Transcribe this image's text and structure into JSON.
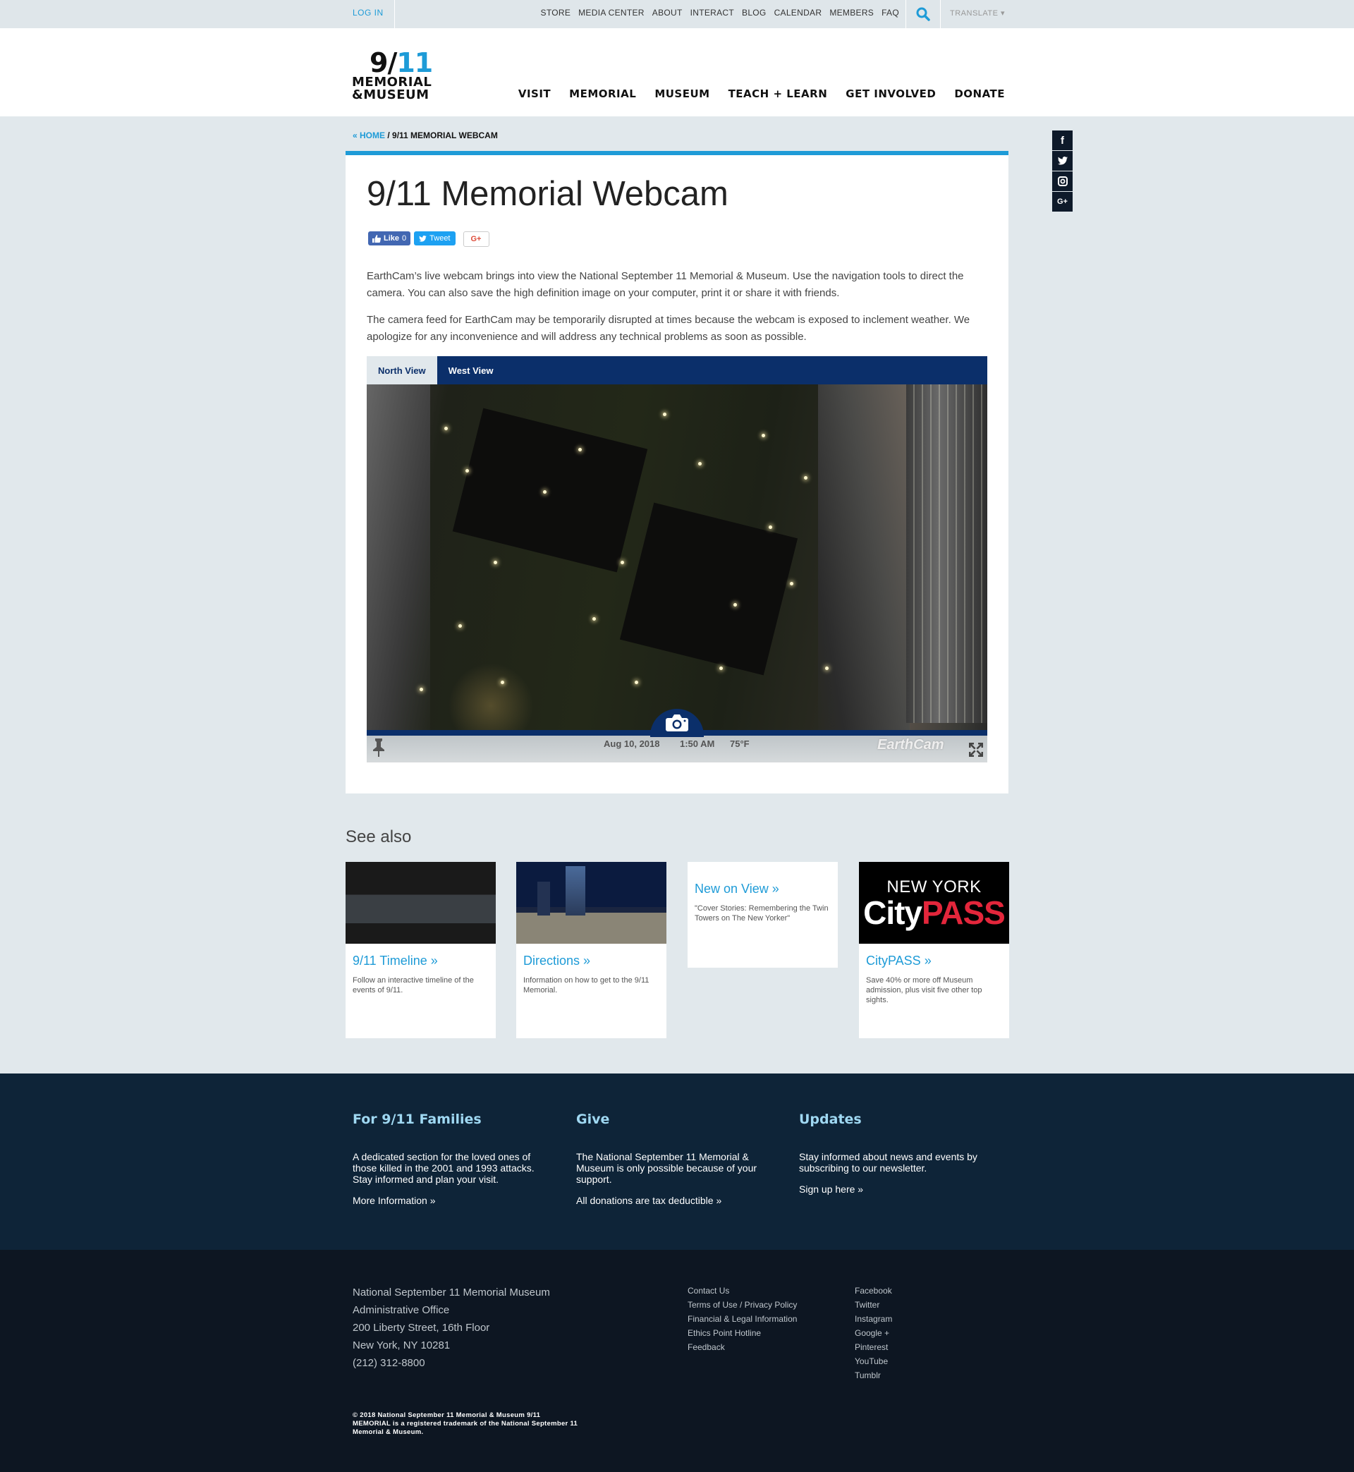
{
  "utility": {
    "login": "LOG IN",
    "links": [
      "STORE",
      "MEDIA CENTER",
      "ABOUT",
      "INTERACT",
      "BLOG",
      "CALENDAR",
      "MEMBERS",
      "FAQ"
    ],
    "translate": "TRANSLATE ▾"
  },
  "logo": {
    "num_a": "9/",
    "num_b": "11",
    "line1": "MEMORIAL",
    "line2": "&MUSEUM"
  },
  "nav": [
    "VISIT",
    "MEMORIAL",
    "MUSEUM",
    "TEACH + LEARN",
    "GET INVOLVED",
    "DONATE"
  ],
  "breadcrumb": {
    "home": "« HOME",
    "sep": " / ",
    "current": "9/11 MEMORIAL WEBCAM"
  },
  "social_side": [
    "f",
    "t",
    "◘",
    "G+"
  ],
  "page": {
    "title": "9/11 Memorial Webcam",
    "share": {
      "like": "Like",
      "like_count": "0",
      "tweet": "Tweet",
      "gplus": "G+"
    },
    "paragraph1": "EarthCam’s live webcam brings into view the National September 11 Memorial & Museum. Use the navigation tools to direct the camera. You can also save the high definition image on your computer, print it or share it with friends.",
    "paragraph2": "The camera feed for EarthCam may be temporarily disrupted at times because the webcam is exposed to inclement weather. We apologize for any inconvenience and will address any technical problems as soon as possible."
  },
  "webcam": {
    "tabs": [
      "North View",
      "West View"
    ],
    "date": "Aug 10, 2018",
    "time": "1:50 AM",
    "temp": "75°F",
    "brand": "EarthCam"
  },
  "see_also": {
    "title": "See also",
    "tiles": [
      {
        "title": "9/11 Timeline »",
        "desc": "Follow an interactive timeline of the events of 9/11."
      },
      {
        "title": "Directions »",
        "desc": "Information on how to get to the 9/11 Memorial."
      },
      {
        "title": "New on View »",
        "desc": "\"Cover Stories: Remembering the Twin Towers on The New Yorker\""
      },
      {
        "title": "CityPASS »",
        "desc": "Save 40% or more off Museum admission, plus visit five other top sights.",
        "img_line1": "NEW YORK",
        "img_city": "City",
        "img_pass": "PASS"
      }
    ]
  },
  "footer_top": [
    {
      "title": "For 9/11 Families",
      "text": "A dedicated section for the loved ones of those killed in the 2001 and 1993 attacks. Stay informed and plan your visit.",
      "link": "More Information »"
    },
    {
      "title": "Give",
      "text": "The National September 11 Memorial & Museum is only possible because of your support.",
      "link": "All donations are tax deductible »"
    },
    {
      "title": "Updates",
      "text": "Stay informed about news and events by subscribing to our newsletter.",
      "link": "Sign up here »"
    }
  ],
  "footer_bottom": {
    "address": [
      "National September 11 Memorial Museum",
      "Administrative Office",
      "200 Liberty Street, 16th Floor",
      "New York, NY 10281",
      "(212) 312-8800"
    ],
    "links": [
      "Contact Us",
      "Terms of Use / Privacy Policy",
      "Financial & Legal Information",
      "Ethics Point Hotline",
      "Feedback"
    ],
    "social": [
      "Facebook",
      "Twitter",
      "Instagram",
      "Google +",
      "Pinterest",
      "YouTube",
      "Tumblr"
    ],
    "copyright": "© 2018 National September 11 Memorial & Museum 9/11 MEMORIAL is a registered trademark of the National September 11 Memorial & Museum."
  },
  "colors": {
    "accent": "#1e9bd7",
    "navy": "#0b2f6a",
    "footer_top": "#0e2438",
    "footer_bottom": "#0d1622"
  },
  "icons": [
    "search-icon",
    "facebook-icon",
    "twitter-icon",
    "instagram-icon",
    "googleplus-icon",
    "camera-icon",
    "pin-icon",
    "expand-icon"
  ]
}
